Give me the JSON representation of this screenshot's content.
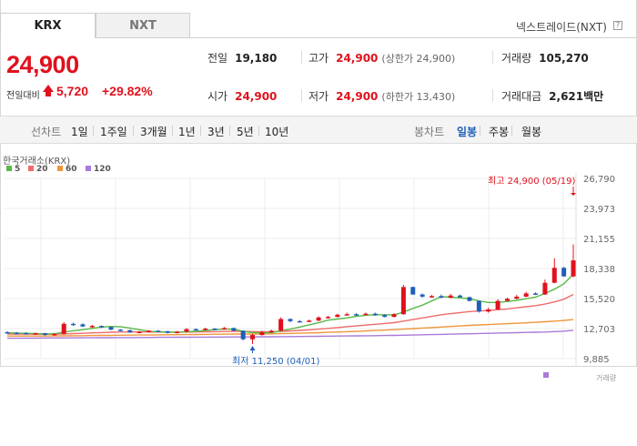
{
  "tabs": {
    "krx": "KRX",
    "nxt": "NXT"
  },
  "nxt_link": "넥스트레이드(NXT)",
  "help_icon": "?",
  "price": {
    "current": "24,900",
    "change_label": "전일대비",
    "change": "5,720",
    "change_pct": "+29.82%"
  },
  "stats": {
    "prev_label": "전일",
    "prev": "19,180",
    "high_label": "고가",
    "high": "24,900",
    "high_sub": "(상한가 24,900)",
    "volume_label": "거래량",
    "volume": "105,270",
    "open_label": "시가",
    "open": "24,900",
    "low_label": "저가",
    "low": "24,900",
    "low_sub": "(하한가 13,430)",
    "amount_label": "거래대금",
    "amount": "2,621",
    "amount_unit": "백만"
  },
  "toolbar": {
    "line_chart": "선차트",
    "d1": "1일",
    "w1": "1주일",
    "m3": "3개월",
    "y1": "1년",
    "y3": "3년",
    "y5": "5년",
    "y10": "10년",
    "candle_chart": "봉차트",
    "daily": "일봉",
    "weekly": "주봉",
    "monthly": "월봉"
  },
  "colors": {
    "up": "#e0111c",
    "down": "#1f5fb8",
    "ma5": "#58b947",
    "ma20": "#ef6b6b",
    "ma60": "#f0953a",
    "ma120": "#a97ad8"
  },
  "chart_data": {
    "type": "candlestick",
    "title": "한국거래소(KRX)",
    "legend": [
      {
        "name": "5",
        "color": "#58b947"
      },
      {
        "name": "20",
        "color": "#ef6b6b"
      },
      {
        "name": "60",
        "color": "#f0953a"
      },
      {
        "name": "120",
        "color": "#a97ad8"
      }
    ],
    "y_ticks": [
      26790,
      23973,
      21155,
      18338,
      15520,
      12703,
      9885
    ],
    "y_tick_labels": [
      "26,790",
      "23,973",
      "21,155",
      "18,338",
      "15,520",
      "12,703",
      "9,885"
    ],
    "ylim": [
      9885,
      26790
    ],
    "annotations": {
      "max": "최고 24,900 (05/19)",
      "min": "최저 11,250 (04/01)"
    },
    "bottom_label": "거래량",
    "candles": [
      [
        12370,
        12300,
        12460,
        12220
      ],
      [
        12300,
        12280,
        12380,
        12200
      ],
      [
        12280,
        12200,
        12360,
        12150
      ],
      [
        12200,
        12260,
        12320,
        12150
      ],
      [
        12260,
        12100,
        12300,
        12050
      ],
      [
        12100,
        12200,
        12280,
        12050
      ],
      [
        12200,
        13150,
        13300,
        12150
      ],
      [
        13150,
        13100,
        13250,
        12950
      ],
      [
        13100,
        12900,
        13200,
        12850
      ],
      [
        12900,
        12950,
        13050,
        12750
      ],
      [
        12950,
        12850,
        13000,
        12750
      ],
      [
        12850,
        12600,
        12900,
        12550
      ],
      [
        12600,
        12550,
        12650,
        12450
      ],
      [
        12550,
        12350,
        12600,
        12300
      ],
      [
        12350,
        12400,
        12480,
        12300
      ],
      [
        12400,
        12500,
        12550,
        12380
      ],
      [
        12500,
        12450,
        12560,
        12380
      ],
      [
        12450,
        12300,
        12500,
        12250
      ],
      [
        12300,
        12400,
        12480,
        12250
      ],
      [
        12400,
        12650,
        12750,
        12350
      ],
      [
        12650,
        12600,
        12720,
        12550
      ],
      [
        12600,
        12700,
        12780,
        12550
      ],
      [
        12700,
        12650,
        12750,
        12550
      ],
      [
        12650,
        12750,
        12850,
        12600
      ],
      [
        12750,
        12500,
        12800,
        12450
      ],
      [
        12500,
        11700,
        12550,
        11600
      ],
      [
        11700,
        12100,
        12200,
        11250
      ],
      [
        12100,
        12350,
        12500,
        12050
      ],
      [
        12350,
        12500,
        12600,
        12300
      ],
      [
        12500,
        13600,
        13750,
        12450
      ],
      [
        13600,
        13400,
        13650,
        13300
      ],
      [
        13400,
        13350,
        13500,
        13300
      ],
      [
        13350,
        13450,
        13550,
        13300
      ],
      [
        13450,
        13750,
        13850,
        13400
      ],
      [
        13750,
        13800,
        13900,
        13650
      ],
      [
        13800,
        14000,
        14100,
        13750
      ],
      [
        14000,
        14050,
        14200,
        13950
      ],
      [
        14050,
        14000,
        14150,
        13900
      ],
      [
        14000,
        14100,
        14200,
        13950
      ],
      [
        14100,
        13950,
        14200,
        13900
      ],
      [
        13950,
        13800,
        14050,
        13750
      ],
      [
        13800,
        14050,
        14150,
        13750
      ],
      [
        14050,
        16600,
        16800,
        14000
      ],
      [
        16600,
        15900,
        16650,
        15850
      ],
      [
        15900,
        15700,
        16000,
        15600
      ],
      [
        15700,
        15750,
        15850,
        15600
      ],
      [
        15750,
        15600,
        15900,
        15550
      ],
      [
        15600,
        15800,
        15950,
        15550
      ],
      [
        15800,
        15650,
        15900,
        15600
      ],
      [
        15650,
        15300,
        15700,
        15250
      ],
      [
        15300,
        14300,
        15350,
        14200
      ],
      [
        14300,
        14500,
        14650,
        14200
      ],
      [
        14500,
        15300,
        15450,
        14450
      ],
      [
        15300,
        15500,
        15600,
        15250
      ],
      [
        15500,
        15700,
        15850,
        15450
      ],
      [
        15700,
        16000,
        16150,
        15650
      ],
      [
        16000,
        15900,
        16100,
        15850
      ],
      [
        15900,
        17000,
        17300,
        15850
      ],
      [
        17000,
        18400,
        19300,
        16950
      ],
      [
        18400,
        17600,
        18500,
        17550
      ],
      [
        17600,
        19100,
        20600,
        17500
      ]
    ],
    "ma5": [
      12300,
      12280,
      12260,
      12240,
      12220,
      12210,
      12380,
      12500,
      12600,
      12720,
      12850,
      12900,
      12880,
      12750,
      12600,
      12450,
      12400,
      12380,
      12350,
      12400,
      12450,
      12520,
      12600,
      12660,
      12650,
      12450,
      12330,
      12300,
      12320,
      12500,
      12650,
      12850,
      13050,
      13250,
      13500,
      13600,
      13700,
      13850,
      13950,
      14000,
      14000,
      13980,
      14250,
      14600,
      14900,
      15300,
      15700,
      15650,
      15580,
      15500,
      15300,
      15150,
      15150,
      15250,
      15350,
      15500,
      15650,
      16000,
      16400,
      16900,
      17800
    ],
    "ma20": [
      12200,
      12190,
      12180,
      12170,
      12170,
      12170,
      12200,
      12230,
      12260,
      12300,
      12330,
      12360,
      12380,
      12390,
      12390,
      12380,
      12380,
      12370,
      12370,
      12380,
      12390,
      12400,
      12410,
      12430,
      12450,
      12440,
      12420,
      12410,
      12410,
      12440,
      12480,
      12530,
      12580,
      12650,
      12720,
      12800,
      12880,
      12950,
      13030,
      13100,
      13180,
      13260,
      13400,
      13550,
      13700,
      13850,
      14000,
      14100,
      14200,
      14300,
      14350,
      14400,
      14470,
      14550,
      14650,
      14750,
      14850,
      15000,
      15200,
      15450,
      15900
    ],
    "ma60": [
      12000,
      12000,
      12000,
      12000,
      12000,
      12010,
      12020,
      12030,
      12040,
      12050,
      12060,
      12070,
      12080,
      12090,
      12100,
      12100,
      12110,
      12120,
      12130,
      12140,
      12150,
      12160,
      12170,
      12180,
      12190,
      12190,
      12190,
      12200,
      12210,
      12230,
      12250,
      12270,
      12290,
      12320,
      12350,
      12380,
      12410,
      12440,
      12480,
      12520,
      12560,
      12600,
      12650,
      12700,
      12750,
      12800,
      12850,
      12900,
      12950,
      13000,
      13040,
      13080,
      13120,
      13160,
      13200,
      13240,
      13290,
      13340,
      13400,
      13460,
      13550
    ],
    "ma120": [
      11800,
      11800,
      11810,
      11810,
      11820,
      11820,
      11830,
      11830,
      11840,
      11840,
      11850,
      11850,
      11860,
      11860,
      11870,
      11870,
      11880,
      11880,
      11890,
      11890,
      11900,
      11900,
      11910,
      11910,
      11920,
      11920,
      11920,
      11930,
      11930,
      11940,
      11950,
      11960,
      11970,
      11980,
      11990,
      12000,
      12010,
      12020,
      12030,
      12040,
      12050,
      12060,
      12080,
      12100,
      12120,
      12140,
      12160,
      12180,
      12200,
      12220,
      12240,
      12260,
      12280,
      12300,
      12320,
      12340,
      12360,
      12380,
      12420,
      12460,
      12540
    ]
  }
}
